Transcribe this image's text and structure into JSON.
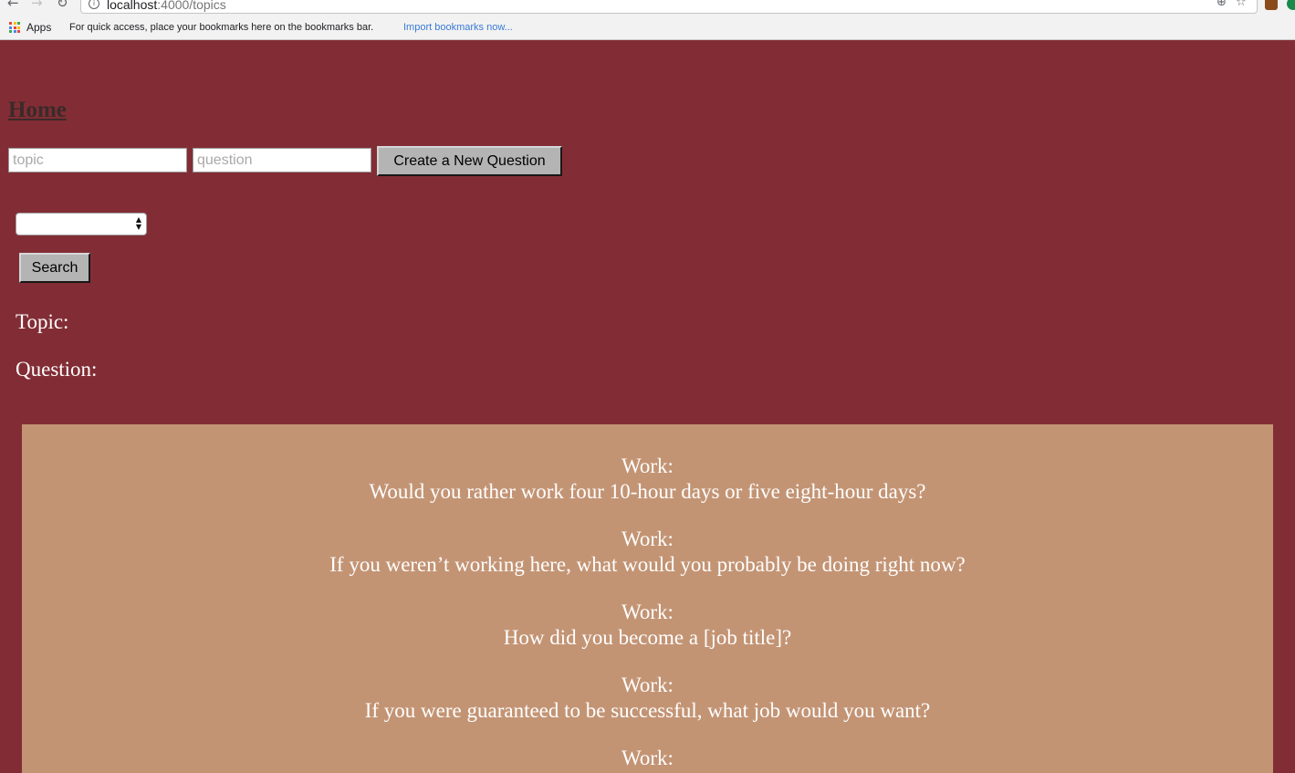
{
  "browser": {
    "url_host": "localhost",
    "url_path": ":4000/topics",
    "bookmarks_bar": {
      "apps_label": "Apps",
      "hint": "For quick access, place your bookmarks here on the bookmarks bar.",
      "import_link": "Import bookmarks now..."
    }
  },
  "page": {
    "home_link": "Home",
    "form": {
      "topic_placeholder": "topic",
      "question_placeholder": "question",
      "create_button": "Create a New Question"
    },
    "search": {
      "selected_value": "",
      "button": "Search"
    },
    "topic_label": "Topic:",
    "question_label": "Question:",
    "questions": [
      {
        "topic": "Work:",
        "question": "Would you rather work four 10-hour days or five eight-hour days?"
      },
      {
        "topic": "Work:",
        "question": "If you weren’t working here, what would you probably be doing right now?"
      },
      {
        "topic": "Work:",
        "question": "How did you become a [job title]?"
      },
      {
        "topic": "Work:",
        "question": "If you were guaranteed to be successful, what job would you want?"
      },
      {
        "topic": "Work:",
        "question": ""
      }
    ]
  }
}
